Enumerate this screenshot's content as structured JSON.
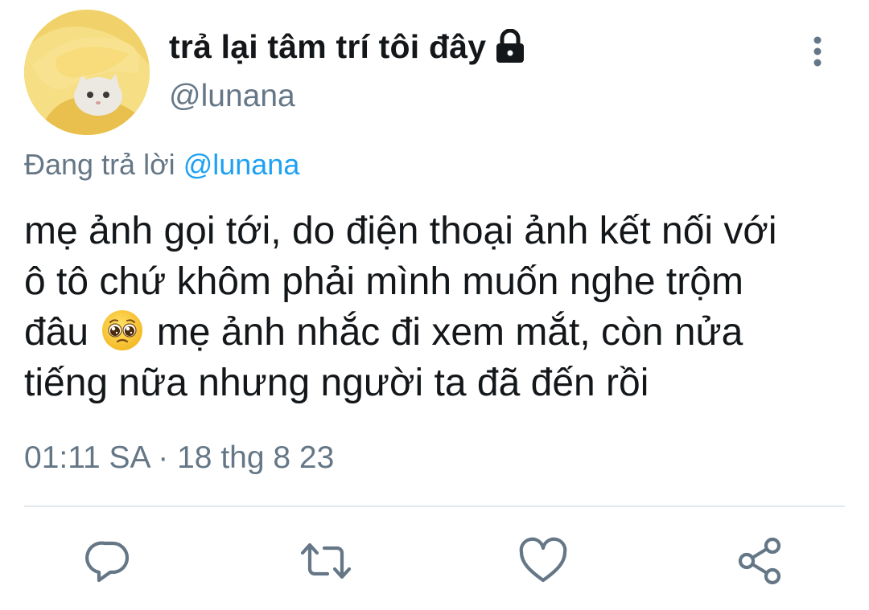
{
  "author": {
    "display_name": "trả lại tâm trí tôi đây",
    "handle": "@lunana",
    "protected_icon": "lock-icon",
    "avatar": "cat-avatar"
  },
  "reply": {
    "prefix": "Đang trả lời",
    "mention": "@lunana"
  },
  "tweet": {
    "line1": "mẹ ảnh gọi tới, do điện thoại ảnh kết nối với",
    "line2": "ô tô chứ khôm phải mình muốn nghe trộm",
    "line3_before_emoji": "đâu",
    "emoji": "pleading-face",
    "line3_after_emoji": "mẹ ảnh nhắc đi xem mắt, còn nửa",
    "line4": "tiếng nữa nhưng người ta đã đến rồi"
  },
  "timestamp": {
    "time": "01:11 SA",
    "separator": "·",
    "date": "18 thg 8 23"
  },
  "actions": [
    {
      "name": "reply",
      "icon": "reply-icon"
    },
    {
      "name": "retweet",
      "icon": "retweet-icon"
    },
    {
      "name": "like",
      "icon": "heart-icon"
    },
    {
      "name": "share",
      "icon": "share-icon"
    }
  ],
  "colors": {
    "text": "#14171a",
    "secondary": "#657786",
    "link": "#1da1f2",
    "divider": "#e1e8ed"
  }
}
